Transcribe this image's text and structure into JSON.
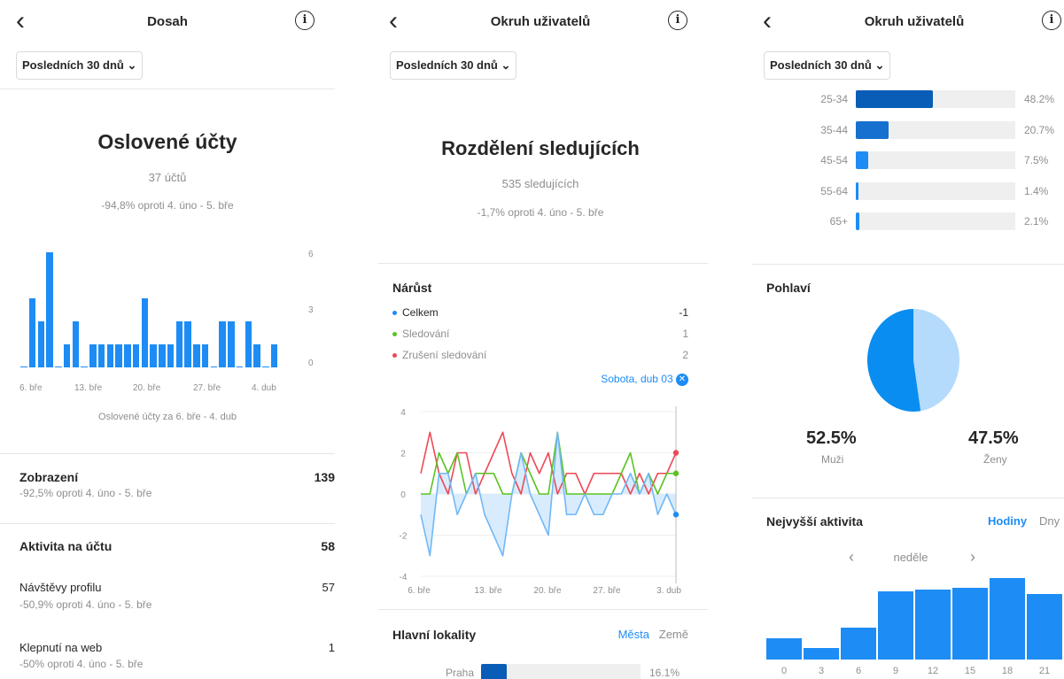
{
  "reach": {
    "title": "Dosah",
    "period": "Posledních 30 dnů",
    "heading": "Oslovené účty",
    "count": "37 účtů",
    "change": "-94,8% oproti 4. úno - 5. bře",
    "chart_caption": "Oslovené účty za 6. bře - 4. dub",
    "y_ticks": [
      "6",
      "3",
      "0"
    ],
    "x_ticks": [
      "6. bře",
      "13. bře",
      "20. bře",
      "27. bře",
      "4. dub"
    ],
    "impressions": {
      "label": "Zobrazení",
      "value": "139",
      "sub": "-92,5% oproti 4. úno - 5. bře"
    },
    "activity": {
      "label": "Aktivita na účtu",
      "value": "58"
    },
    "profile_visits": {
      "label": "Návštěvy profilu",
      "value": "57",
      "sub": "-50,9% oproti 4. úno - 5. bře"
    },
    "web_taps": {
      "label": "Klepnutí na web",
      "value": "1",
      "sub": "-50% oproti 4. úno - 5. bře"
    }
  },
  "followers": {
    "title": "Okruh uživatelů",
    "period": "Posledních 30 dnů",
    "heading": "Rozdělení sledujících",
    "count": "535 sledujících",
    "change": "-1,7% oproti 4. úno - 5. bře",
    "growth_title": "Nárůst",
    "legend": [
      {
        "label": "Celkem",
        "value": "-1",
        "color": "#1d8cf5"
      },
      {
        "label": "Sledování",
        "value": "1",
        "color": "#58c322"
      },
      {
        "label": "Zrušení sledování",
        "value": "2",
        "color": "#ed4956"
      }
    ],
    "selected_day": "Sobota, dub 03",
    "y_ticks": [
      "4",
      "2",
      "0",
      "-2",
      "-4"
    ],
    "x_ticks": [
      "6. bře",
      "13. bře",
      "20. bře",
      "27. bře",
      "3. dub"
    ],
    "locations_title": "Hlavní lokality",
    "tab_cities": "Města",
    "tab_countries": "Země",
    "top_city": {
      "name": "Praha",
      "pct": "16.1%",
      "fraction": 0.161
    }
  },
  "audience": {
    "title": "Okruh uživatelů",
    "period": "Posledních 30 dnů",
    "ages": [
      {
        "label": "25-34",
        "pct": "48.2%",
        "fraction": 0.482,
        "color": "#0a5db6"
      },
      {
        "label": "35-44",
        "pct": "20.7%",
        "fraction": 0.207,
        "color": "#1570d0"
      },
      {
        "label": "45-54",
        "pct": "7.5%",
        "fraction": 0.075,
        "color": "#1d8cf5"
      },
      {
        "label": "55-64",
        "pct": "1.4%",
        "fraction": 0.014,
        "color": "#1d8cf5"
      },
      {
        "label": "65+",
        "pct": "2.1%",
        "fraction": 0.021,
        "color": "#1d8cf5"
      }
    ],
    "gender_title": "Pohlaví",
    "men": {
      "pct": "52.5%",
      "label": "Muži",
      "fraction": 0.525,
      "color": "#0a8df0"
    },
    "women": {
      "pct": "47.5%",
      "label": "Ženy",
      "fraction": 0.475,
      "color": "#b4dafc"
    },
    "activity_title": "Nejvyšší aktivita",
    "tab_hours": "Hodiny",
    "tab_days": "Dny",
    "day": "neděle",
    "hour_ticks": [
      "0",
      "3",
      "6",
      "9",
      "12",
      "15",
      "18",
      "21"
    ]
  },
  "chart_data": [
    {
      "type": "bar",
      "title": "Oslovené účty",
      "xlabel": "Oslovené účty za 6. bře - 4. dub",
      "ylim": [
        0,
        6
      ],
      "categories": [
        "6. bře",
        "7. bře",
        "8. bře",
        "9. bře",
        "10. bře",
        "11. bře",
        "12. bře",
        "13. bře",
        "14. bře",
        "15. bře",
        "16. bře",
        "17. bře",
        "18. bře",
        "19. bře",
        "20. bře",
        "21. bře",
        "22. bře",
        "23. bře",
        "24. bře",
        "25. bře",
        "26. bře",
        "27. bře",
        "28. bře",
        "29. bře",
        "30. bře",
        "31. bře",
        "1. dub",
        "2. dub",
        "3. dub",
        "4. dub"
      ],
      "values": [
        0,
        3.6,
        2.4,
        6,
        0,
        1.2,
        2.4,
        0,
        1.2,
        1.2,
        1.2,
        1.2,
        1.2,
        1.2,
        3.6,
        1.2,
        1.2,
        1.2,
        2.4,
        2.4,
        1.2,
        1.2,
        0,
        2.4,
        2.4,
        0,
        2.4,
        1.2,
        0,
        1.2
      ]
    },
    {
      "type": "line",
      "title": "Nárůst",
      "ylim": [
        -4,
        4
      ],
      "x": [
        "6. bře",
        "7. bře",
        "8. bře",
        "9. bře",
        "10. bře",
        "11. bře",
        "12. bře",
        "13. bře",
        "14. bře",
        "15. bře",
        "16. bře",
        "17. bře",
        "18. bře",
        "19. bře",
        "20. bře",
        "21. bře",
        "22. bře",
        "23. bře",
        "24. bře",
        "25. bře",
        "26. bře",
        "27. bře",
        "28. bře",
        "29. bře",
        "30. bře",
        "31. bře",
        "1. dub",
        "2. dub",
        "3. dub"
      ],
      "series": [
        {
          "name": "Celkem",
          "values": [
            -1,
            -3,
            1,
            1,
            -1,
            0,
            1,
            -1,
            -2,
            -3,
            0,
            2,
            0,
            -1,
            -2,
            3,
            -1,
            -1,
            0,
            -1,
            -1,
            0,
            0,
            1,
            0,
            1,
            -1,
            0,
            -1
          ]
        },
        {
          "name": "Sledování",
          "values": [
            0,
            0,
            2,
            1,
            2,
            0,
            1,
            1,
            1,
            0,
            0,
            2,
            1,
            0,
            0,
            3,
            0,
            0,
            0,
            0,
            0,
            0,
            1,
            2,
            0,
            1,
            0,
            1,
            1
          ]
        },
        {
          "name": "Zrušení sledování",
          "values": [
            1,
            3,
            1,
            0,
            2,
            2,
            0,
            1,
            2,
            3,
            1,
            0,
            2,
            1,
            2,
            0,
            1,
            1,
            0,
            1,
            1,
            1,
            1,
            0,
            1,
            0,
            1,
            1,
            2
          ]
        }
      ]
    },
    {
      "type": "pie",
      "title": "Pohlaví",
      "categories": [
        "Muži",
        "Ženy"
      ],
      "values": [
        52.5,
        47.5
      ]
    },
    {
      "type": "bar",
      "title": "Nejvyšší aktivita",
      "categories": [
        "0",
        "3",
        "6",
        "9",
        "12",
        "15",
        "18",
        "21"
      ],
      "values": [
        34,
        19,
        52,
        110,
        113,
        116,
        132,
        106
      ]
    }
  ]
}
